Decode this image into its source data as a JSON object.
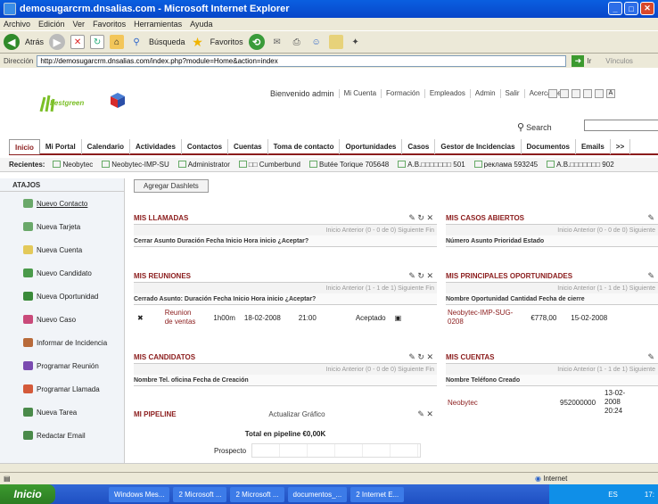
{
  "window": {
    "title": "demosugarcrm.dnsalias.com - Microsoft Internet Explorer",
    "menu": [
      "Archivo",
      "Edición",
      "Ver",
      "Favoritos",
      "Herramientas",
      "Ayuda"
    ],
    "toolbar": {
      "back": "Atrás",
      "search": "Búsqueda",
      "favorites": "Favoritos"
    },
    "address_label": "Dirección",
    "address_url": "http://demosugarcrm.dnsalias.com/index.php?module=Home&action=index",
    "go": "Ir",
    "links": "Vínculos",
    "status_zone": "Internet"
  },
  "app": {
    "logo_text": "bestgreen",
    "welcome": "Bienvenido admin",
    "topnav": [
      "Mi Cuenta",
      "Formación",
      "Empleados",
      "Admin",
      "Salir",
      "Acerca de"
    ],
    "search_label": "Search",
    "tabs": [
      "Inicio",
      "Mi Portal",
      "Calendario",
      "Actividades",
      "Contactos",
      "Cuentas",
      "Toma de contacto",
      "Oportunidades",
      "Casos",
      "Gestor de Incidencias",
      "Documentos",
      "Emails",
      ">>"
    ],
    "recent_label": "Recientes:",
    "recent": [
      "Neobytec",
      "Neobytec-IMP-SU",
      "Administrator",
      "□□ Cumberbund",
      "Butée Torique 705648",
      "A.B.□□□□□□□ 501",
      "реклама 593245",
      "A.B.□□□□□□□ 902"
    ]
  },
  "sidebar": {
    "title": "ATAJOS",
    "items": [
      "Nuevo Contacto",
      "Nueva Tarjeta",
      "Nueva Cuenta",
      "Nuevo Candidato",
      "Nueva Oportunidad",
      "Nuevo Caso",
      "Informar de Incidencia",
      "Programar Reunión",
      "Programar Llamada",
      "Nueva Tarea",
      "Redactar Email"
    ]
  },
  "dashlets": {
    "add_label": "Agregar Dashlets",
    "llamadas": {
      "title": "MIS LLAMADAS",
      "pager": "Inicio  Anterior (0 - 0 de 0) Siguiente  Fin",
      "cols": "Cerrar  Asunto      Duración  Fecha Inicio  Hora inicio  ¿Aceptar?"
    },
    "reuniones": {
      "title": "MIS REUNIONES",
      "pager": "Inicio  Anterior (1 - 1 de 1) Siguiente  Fin",
      "cols": "Cerrado  Asunto:  Duración  Fecha Inicio  Hora inicio  ¿Aceptar?",
      "row": {
        "subject_1": "Reunion",
        "subject_2": "de ventas",
        "duration": "1h00m",
        "date": "18-02-2008",
        "time": "21:00",
        "accepted": "Aceptado"
      }
    },
    "candidatos": {
      "title": "MIS CANDIDATOS",
      "pager": "Inicio  Anterior (0 - 0 de 0) Siguiente  Fin",
      "cols": "Nombre            Tel. oficina  Fecha de Creación"
    },
    "pipeline": {
      "title": "MI PIPELINE",
      "update": "Actualizar Gráfico",
      "total": "Total en pipeline €0,00K",
      "stage": "Prospecto"
    },
    "casos": {
      "title": "MIS CASOS ABIERTOS",
      "pager": "Inicio  Anterior (0 - 0 de 0) Siguiente",
      "cols": "Número  Asunto          Prioridad  Estado"
    },
    "oportunidades": {
      "title": "MIS PRINCIPALES OPORTUNIDADES",
      "pager": "Inicio  Anterior (1 - 1 de 1) Siguiente",
      "cols": "Nombre Oportunidad  Cantidad  Fecha de cierre",
      "row": {
        "name_1": "Neobytec-IMP-SUG-",
        "name_2": "0208",
        "amount": "€778,00",
        "date": "15-02-2008"
      }
    },
    "cuentas": {
      "title": "MIS CUENTAS",
      "pager": "Inicio  Anterior (1 - 1 de 1) Siguiente",
      "cols": "Nombre            Teléfono  Creado",
      "row": {
        "name": "Neobytec",
        "phone": "952000000",
        "created_1": "13-02-",
        "created_2": "2008",
        "created_3": "20:24"
      }
    }
  },
  "taskbar": {
    "start": "Inicio",
    "items": [
      "Windows Mes...",
      "2 Microsoft ...",
      "2 Microsoft ...",
      "documentos_...",
      "2 Internet E..."
    ],
    "lang": "ES",
    "clock": "17:"
  }
}
